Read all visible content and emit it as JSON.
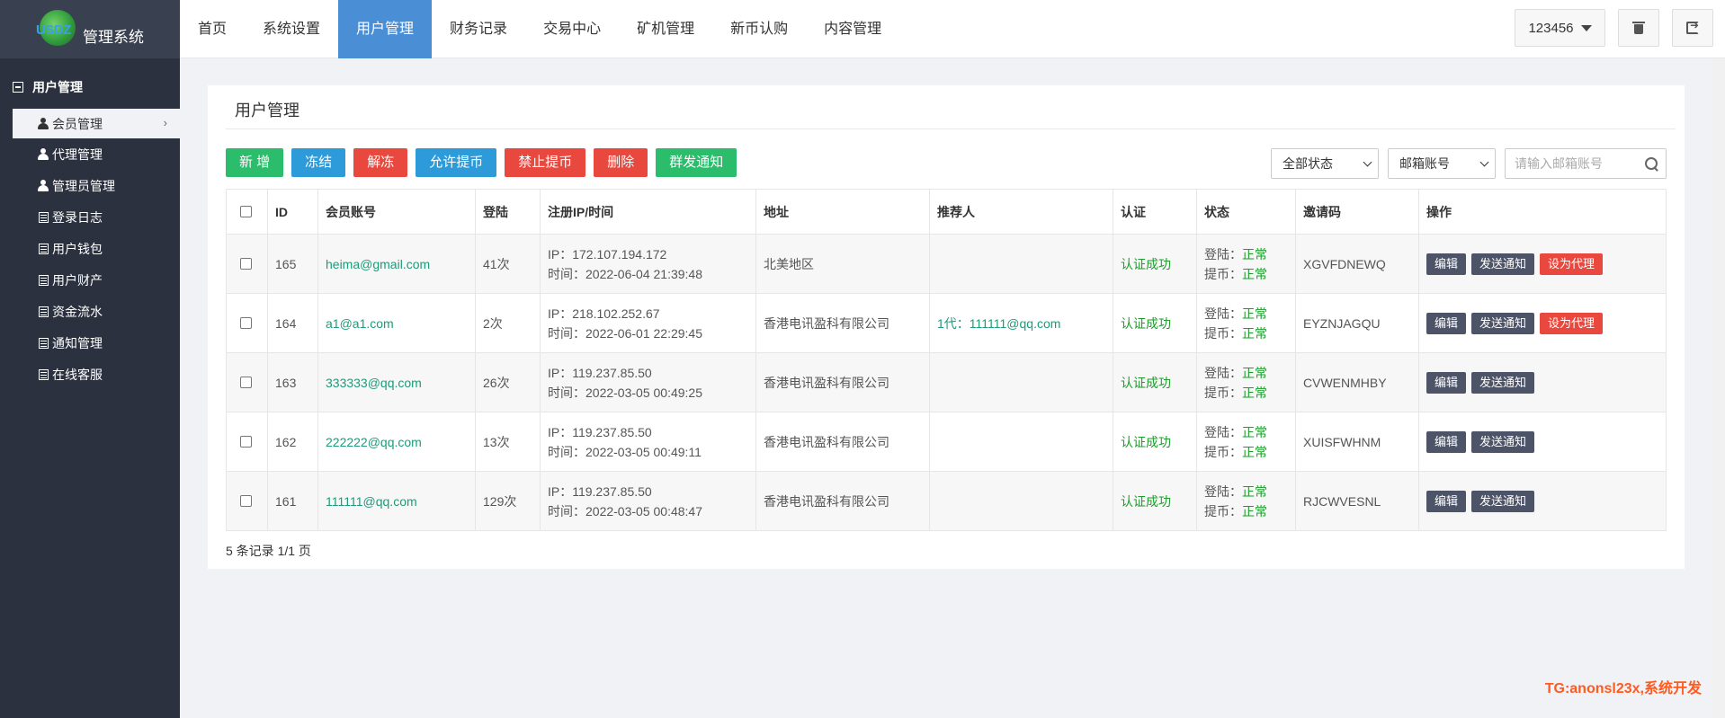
{
  "app": {
    "logo_text": "USDZ",
    "title": "管理系统"
  },
  "sidebar": {
    "group_label": "用户管理",
    "items": [
      {
        "label": "会员管理",
        "icon": "user-icon",
        "active": true
      },
      {
        "label": "代理管理",
        "icon": "user-icon"
      },
      {
        "label": "管理员管理",
        "icon": "user-icon"
      },
      {
        "label": "登录日志",
        "icon": "list-icon"
      },
      {
        "label": "用户钱包",
        "icon": "list-icon"
      },
      {
        "label": "用户财产",
        "icon": "list-icon"
      },
      {
        "label": "资金流水",
        "icon": "list-icon"
      },
      {
        "label": "通知管理",
        "icon": "list-icon"
      },
      {
        "label": "在线客服",
        "icon": "list-icon"
      }
    ]
  },
  "topnav": {
    "tabs": [
      "首页",
      "系统设置",
      "用户管理",
      "财务记录",
      "交易中心",
      "矿机管理",
      "新币认购",
      "内容管理"
    ],
    "active_tab": "用户管理",
    "user": "123456"
  },
  "panel": {
    "title": "用户管理",
    "buttons": {
      "add": "新 增",
      "freeze": "冻结",
      "unfreeze": "解冻",
      "allow_withdraw": "允许提币",
      "ban_withdraw": "禁止提币",
      "delete": "删除",
      "notify_all": "群发通知"
    },
    "filters": {
      "status_select": "全部状态",
      "field_select": "邮箱账号",
      "search_placeholder": "请输入邮箱账号"
    }
  },
  "table": {
    "headers": [
      "ID",
      "会员账号",
      "登陆",
      "注册IP/时间",
      "地址",
      "推荐人",
      "认证",
      "状态",
      "邀请码",
      "操作"
    ],
    "rows": [
      {
        "id": "165",
        "account": "heima@gmail.com",
        "logins": "41次",
        "ip": "IP：172.107.194.172",
        "time": "时间：2022-06-04 21:39:48",
        "address": "北美地区",
        "referrer": "",
        "auth": "认证成功",
        "login_status_label": "登陆：",
        "login_status": "正常",
        "withdraw_status_label": "提币：",
        "withdraw_status": "正常",
        "invite": "XGVFDNEWQ",
        "ops": [
          "编辑",
          "发送通知",
          "设为代理"
        ]
      },
      {
        "id": "164",
        "account": "a1@a1.com",
        "logins": "2次",
        "ip": "IP：218.102.252.67",
        "time": "时间：2022-06-01 22:29:45",
        "address": "香港电讯盈科有限公司",
        "referrer": "1代：111111@qq.com",
        "auth": "认证成功",
        "login_status_label": "登陆：",
        "login_status": "正常",
        "withdraw_status_label": "提币：",
        "withdraw_status": "正常",
        "invite": "EYZNJAGQU",
        "ops": [
          "编辑",
          "发送通知",
          "设为代理"
        ]
      },
      {
        "id": "163",
        "account": "333333@qq.com",
        "logins": "26次",
        "ip": "IP：119.237.85.50",
        "time": "时间：2022-03-05 00:49:25",
        "address": "香港电讯盈科有限公司",
        "referrer": "",
        "auth": "认证成功",
        "login_status_label": "登陆：",
        "login_status": "正常",
        "withdraw_status_label": "提币：",
        "withdraw_status": "正常",
        "invite": "CVWENMHBY",
        "ops": [
          "编辑",
          "发送通知"
        ]
      },
      {
        "id": "162",
        "account": "222222@qq.com",
        "logins": "13次",
        "ip": "IP：119.237.85.50",
        "time": "时间：2022-03-05 00:49:11",
        "address": "香港电讯盈科有限公司",
        "referrer": "",
        "auth": "认证成功",
        "login_status_label": "登陆：",
        "login_status": "正常",
        "withdraw_status_label": "提币：",
        "withdraw_status": "正常",
        "invite": "XUISFWHNM",
        "ops": [
          "编辑",
          "发送通知"
        ]
      },
      {
        "id": "161",
        "account": "111111@qq.com",
        "logins": "129次",
        "ip": "IP：119.237.85.50",
        "time": "时间：2022-03-05 00:48:47",
        "address": "香港电讯盈科有限公司",
        "referrer": "",
        "auth": "认证成功",
        "login_status_label": "登陆：",
        "login_status": "正常",
        "withdraw_status_label": "提币：",
        "withdraw_status": "正常",
        "invite": "RJCWVESNL",
        "ops": [
          "编辑",
          "发送通知"
        ]
      }
    ],
    "pager": "5 条记录 1/1 页"
  },
  "watermark": "TG:anonsl23x,系统开发",
  "colors": {
    "sidebar_bg": "#2b313e",
    "active_tab": "#4a8fd6",
    "green": "#2bbd6b",
    "blue": "#2d9ad9",
    "red": "#e8483d"
  }
}
